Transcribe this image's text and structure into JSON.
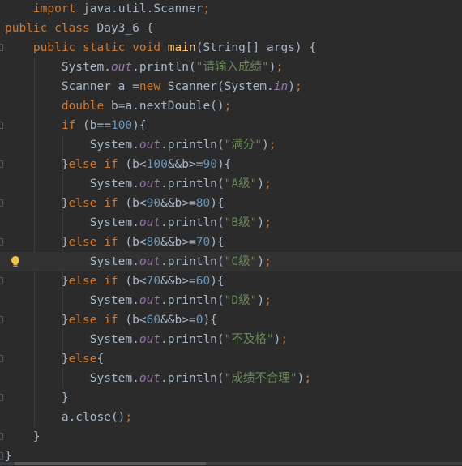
{
  "editor": {
    "lines": [
      [
        {
          "t": "    "
        },
        {
          "t": "import",
          "c": "kw"
        },
        {
          "t": " java.util.Scanner"
        },
        {
          "t": ";",
          "c": "kw"
        }
      ],
      [
        {
          "t": "public class",
          "c": "kw"
        },
        {
          "t": " Day3_6 {"
        }
      ],
      [
        {
          "t": "    "
        },
        {
          "t": "public static void",
          "c": "kw"
        },
        {
          "t": " "
        },
        {
          "t": "main",
          "c": "fn"
        },
        {
          "t": "(String[] args) {"
        }
      ],
      [
        {
          "t": "        System."
        },
        {
          "t": "out",
          "c": "st"
        },
        {
          "t": ".println("
        },
        {
          "t": "\"请输入成绩\"",
          "c": "str"
        },
        {
          "t": ")"
        },
        {
          "t": ";",
          "c": "kw"
        }
      ],
      [
        {
          "t": "        Scanner a ="
        },
        {
          "t": "new",
          "c": "kw"
        },
        {
          "t": " Scanner(System."
        },
        {
          "t": "in",
          "c": "st"
        },
        {
          "t": ")"
        },
        {
          "t": ";",
          "c": "kw"
        }
      ],
      [
        {
          "t": "        "
        },
        {
          "t": "double",
          "c": "kw"
        },
        {
          "t": " b=a.nextDouble()"
        },
        {
          "t": ";",
          "c": "kw"
        }
      ],
      [
        {
          "t": "        "
        },
        {
          "t": "if",
          "c": "kw"
        },
        {
          "t": " (b=="
        },
        {
          "t": "100",
          "c": "num"
        },
        {
          "t": "){"
        }
      ],
      [
        {
          "t": "            System."
        },
        {
          "t": "out",
          "c": "st"
        },
        {
          "t": ".println("
        },
        {
          "t": "\"满分\"",
          "c": "str"
        },
        {
          "t": ")"
        },
        {
          "t": ";",
          "c": "kw"
        }
      ],
      [
        {
          "t": "        }"
        },
        {
          "t": "else if",
          "c": "kw"
        },
        {
          "t": " (b<"
        },
        {
          "t": "100",
          "c": "num"
        },
        {
          "t": "&&b>="
        },
        {
          "t": "90",
          "c": "num"
        },
        {
          "t": "){"
        }
      ],
      [
        {
          "t": "            System."
        },
        {
          "t": "out",
          "c": "st"
        },
        {
          "t": ".println("
        },
        {
          "t": "\"A级\"",
          "c": "str"
        },
        {
          "t": ")"
        },
        {
          "t": ";",
          "c": "kw"
        }
      ],
      [
        {
          "t": "        }"
        },
        {
          "t": "else if",
          "c": "kw"
        },
        {
          "t": " (b<"
        },
        {
          "t": "90",
          "c": "num"
        },
        {
          "t": "&&b>="
        },
        {
          "t": "80",
          "c": "num"
        },
        {
          "t": "){"
        }
      ],
      [
        {
          "t": "            System."
        },
        {
          "t": "out",
          "c": "st"
        },
        {
          "t": ".println("
        },
        {
          "t": "\"B级\"",
          "c": "str"
        },
        {
          "t": ")"
        },
        {
          "t": ";",
          "c": "kw"
        }
      ],
      [
        {
          "t": "        }"
        },
        {
          "t": "else if",
          "c": "kw"
        },
        {
          "t": " (b<"
        },
        {
          "t": "80",
          "c": "num"
        },
        {
          "t": "&&b>="
        },
        {
          "t": "70",
          "c": "num"
        },
        {
          "t": "){"
        }
      ],
      [
        {
          "t": "            System."
        },
        {
          "t": "out",
          "c": "st"
        },
        {
          "t": ".println("
        },
        {
          "t": "\"C级\"",
          "c": "str"
        },
        {
          "t": ")"
        },
        {
          "t": ";",
          "c": "kw"
        }
      ],
      [
        {
          "t": "        }"
        },
        {
          "t": "else if",
          "c": "kw"
        },
        {
          "t": " (b<"
        },
        {
          "t": "70",
          "c": "num"
        },
        {
          "t": "&&b>="
        },
        {
          "t": "60",
          "c": "num"
        },
        {
          "t": "){"
        }
      ],
      [
        {
          "t": "            System."
        },
        {
          "t": "out",
          "c": "st"
        },
        {
          "t": ".println("
        },
        {
          "t": "\"D级\"",
          "c": "str"
        },
        {
          "t": ")"
        },
        {
          "t": ";",
          "c": "kw"
        }
      ],
      [
        {
          "t": "        }"
        },
        {
          "t": "else if",
          "c": "kw"
        },
        {
          "t": " (b<"
        },
        {
          "t": "60",
          "c": "num"
        },
        {
          "t": "&&b>="
        },
        {
          "t": "0",
          "c": "num"
        },
        {
          "t": "){"
        }
      ],
      [
        {
          "t": "            System."
        },
        {
          "t": "out",
          "c": "st"
        },
        {
          "t": ".println("
        },
        {
          "t": "\"不及格\"",
          "c": "str"
        },
        {
          "t": ")"
        },
        {
          "t": ";",
          "c": "kw"
        }
      ],
      [
        {
          "t": "        }"
        },
        {
          "t": "else",
          "c": "kw"
        },
        {
          "t": "{"
        }
      ],
      [
        {
          "t": "            System."
        },
        {
          "t": "out",
          "c": "st"
        },
        {
          "t": ".println("
        },
        {
          "t": "\"成绩不合理\"",
          "c": "str"
        },
        {
          "t": ")"
        },
        {
          "t": ";",
          "c": "kw"
        }
      ],
      [
        {
          "t": "        }"
        }
      ],
      [
        {
          "t": "        a.close()"
        },
        {
          "t": ";",
          "c": "kw"
        }
      ],
      [
        {
          "t": "    }"
        }
      ],
      [
        {
          "t": "}"
        }
      ]
    ],
    "current_line_index": 13,
    "fold_open_lines": [
      2,
      6
    ],
    "fold_close_lines": [
      8,
      10,
      12,
      14,
      16,
      18,
      20,
      22,
      23
    ],
    "intention_icon": "lightbulb-icon"
  },
  "colors": {
    "background": "#2b2b2b",
    "default_text": "#a9b7c6",
    "keyword": "#cc7832",
    "method_declaration": "#ffc66d",
    "string": "#6a8759",
    "number": "#6897bb",
    "static_field": "#9876aa",
    "current_line": "#323232",
    "bulb": "#f0c34a"
  }
}
